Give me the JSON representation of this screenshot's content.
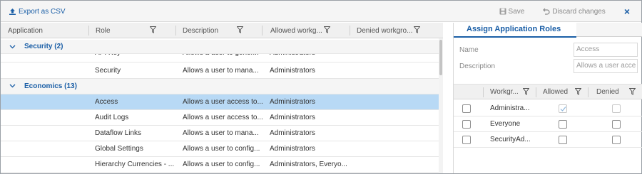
{
  "toolbar": {
    "export_label": "Export as CSV",
    "save_label": "Save",
    "discard_label": "Discard changes",
    "close_label": "×"
  },
  "grid": {
    "columns": [
      "Application",
      "Role",
      "Description",
      "Allowed workg...",
      "Denied workgro..."
    ],
    "groups": [
      {
        "label": "Security (2)",
        "rows": [
          {
            "role": "API Key",
            "description": "Allows a user to gener...",
            "allowed": "Administrators"
          },
          {
            "role": "Security",
            "description": "Allows a user to mana...",
            "allowed": "Administrators"
          }
        ]
      },
      {
        "label": "Economics (13)",
        "rows": [
          {
            "role": "Access",
            "description": "Allows a user access to...",
            "allowed": "Administrators",
            "selected": true
          },
          {
            "role": "Audit Logs",
            "description": "Allows a user access to...",
            "allowed": "Administrators"
          },
          {
            "role": "Dataflow Links",
            "description": "Allows a user to mana...",
            "allowed": "Administrators"
          },
          {
            "role": "Global Settings",
            "description": "Allows a user to config...",
            "allowed": "Administrators"
          },
          {
            "role": "Hierarchy Currencies - ...",
            "description": "Allows a user to config...",
            "allowed": "Administrators, Everyo..."
          }
        ]
      }
    ],
    "selected_row_color": "#b8d9f5"
  },
  "panel": {
    "tab_label": "Assign Application Roles",
    "name_label": "Name",
    "name_value": "Access",
    "description_label": "Description",
    "description_value": "Allows a user acce",
    "columns": [
      "Workgr...",
      "Allowed",
      "Denied"
    ],
    "rows": [
      {
        "name": "Administra...",
        "allowed": true,
        "allowed_disabled": true,
        "denied": false,
        "denied_disabled": true
      },
      {
        "name": "Everyone",
        "allowed": false,
        "allowed_disabled": false,
        "denied": false,
        "denied_disabled": false
      },
      {
        "name": "SecurityAd...",
        "allowed": false,
        "allowed_disabled": false,
        "denied": false,
        "denied_disabled": false
      }
    ]
  },
  "icons": {
    "export": "upload-icon",
    "save": "floppy-disk-icon",
    "discard": "undo-icon",
    "filter": "filter-icon",
    "expand": "chevron-down-icon"
  },
  "colors": {
    "accent": "#1a5ea6",
    "toolbar_bg": "#f5f5f5",
    "muted_text": "#8a8a8a"
  }
}
